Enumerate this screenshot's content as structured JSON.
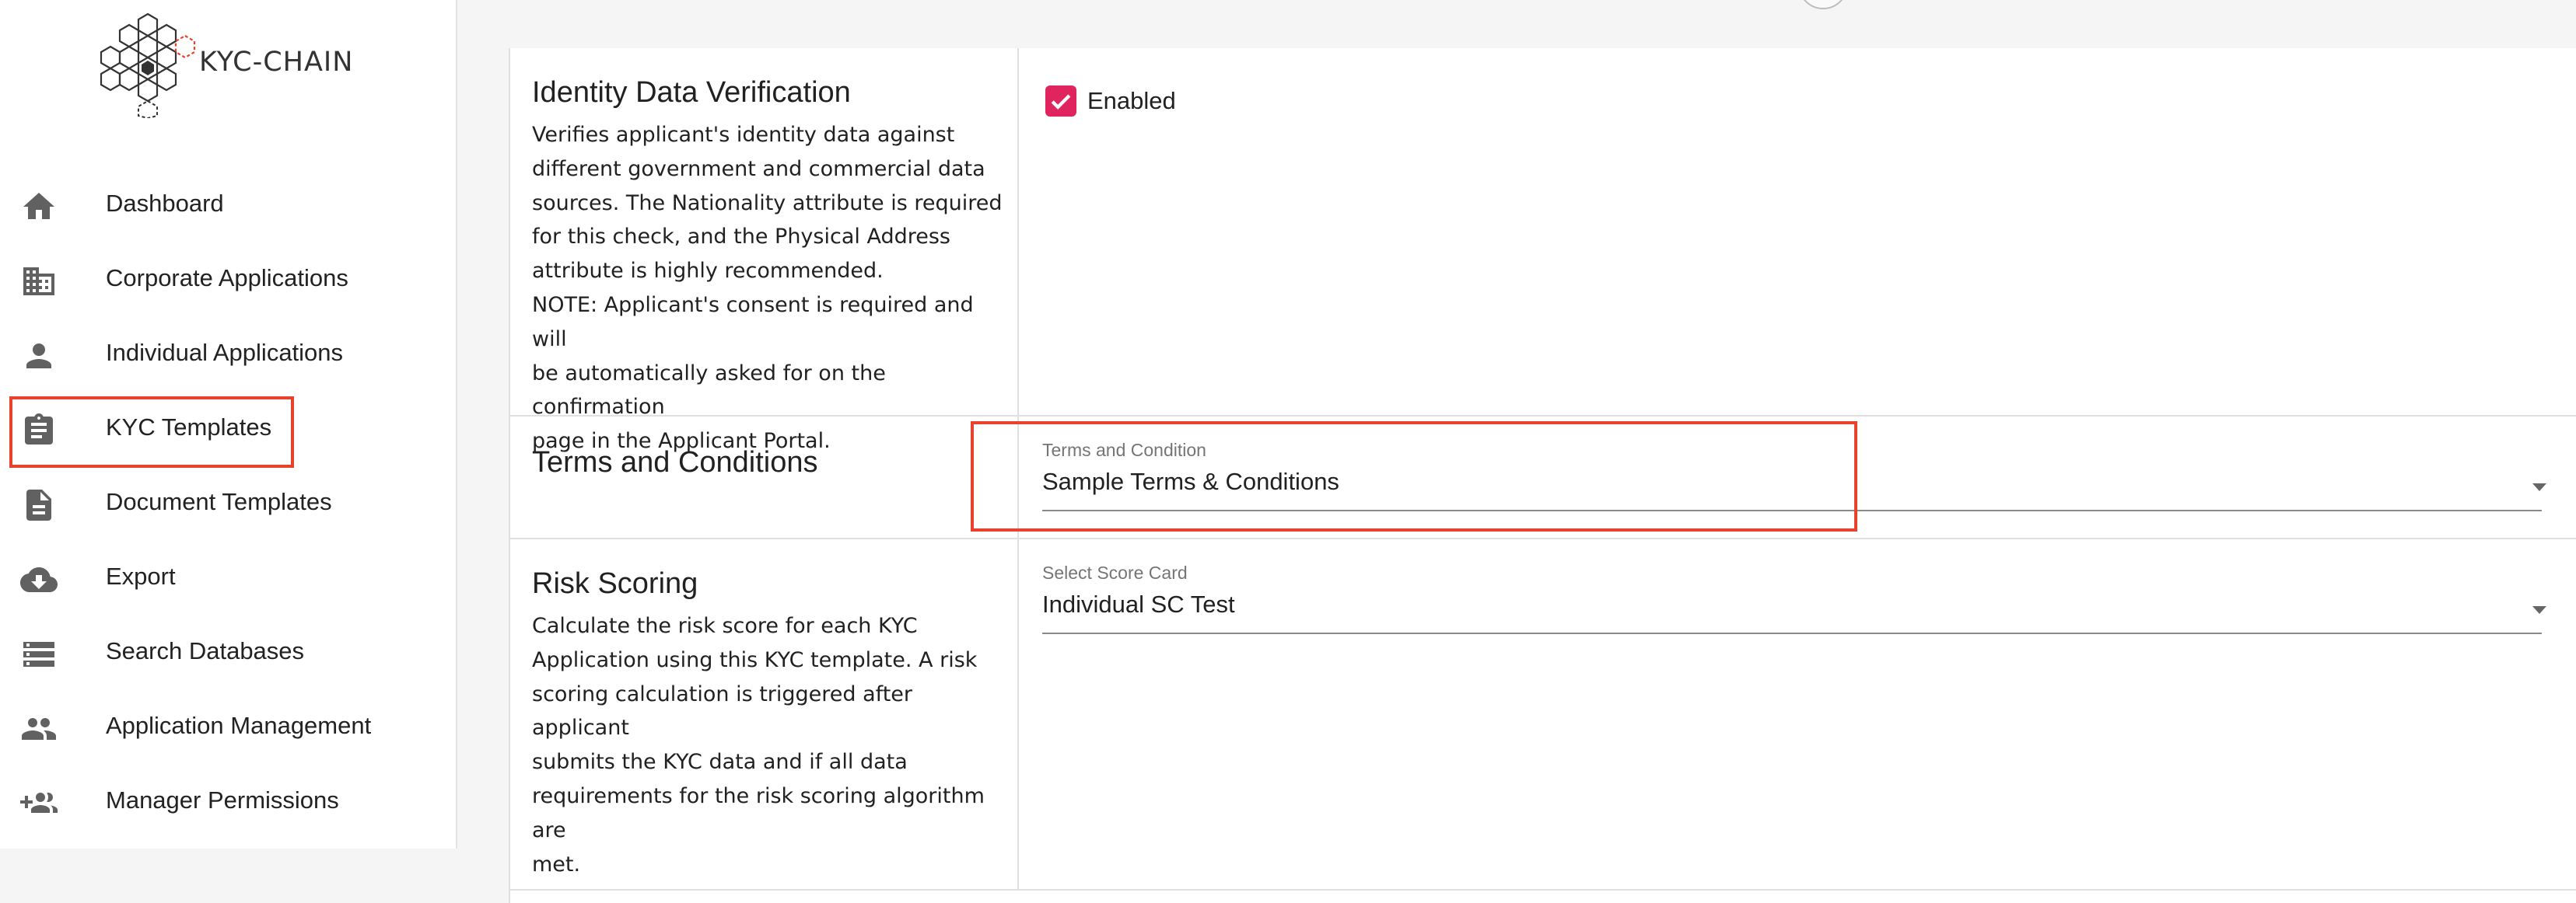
{
  "app": {
    "logo_text": "KYC-CHAIN"
  },
  "sidebar": {
    "items": [
      {
        "label": "Dashboard",
        "icon": "home-icon"
      },
      {
        "label": "Corporate Applications",
        "icon": "building-icon"
      },
      {
        "label": "Individual Applications",
        "icon": "person-icon"
      },
      {
        "label": "KYC Templates",
        "icon": "clipboard-icon"
      },
      {
        "label": "Document Templates",
        "icon": "document-icon"
      },
      {
        "label": "Export",
        "icon": "cloud-download-icon"
      },
      {
        "label": "Search Databases",
        "icon": "list-icon"
      },
      {
        "label": "Application Management",
        "icon": "group-icon"
      },
      {
        "label": "Manager Permissions",
        "icon": "add-group-icon"
      }
    ],
    "active": "KYC Templates"
  },
  "sections": {
    "identity": {
      "title": "Identity Data Verification",
      "description_lines": [
        "Verifies applicant's identity data against",
        "different government and commercial data",
        "sources. The Nationality attribute is required",
        "for this check, and the Physical Address",
        "attribute is highly recommended.",
        "NOTE: Applicant's consent is required and will",
        "be automatically asked for on the confirmation",
        "page in the Applicant Portal."
      ],
      "checkbox_label": "Enabled",
      "checked": true
    },
    "terms": {
      "title": "Terms and Conditions",
      "select_label": "Terms and Condition",
      "select_value": "Sample Terms & Conditions"
    },
    "risk": {
      "title": "Risk Scoring",
      "description_lines": [
        "Calculate the risk score for each KYC",
        "Application using this KYC template. A risk",
        "scoring calculation is triggered after applicant",
        "submits the KYC data and if all data",
        "requirements for the risk scoring algorithm are",
        "met."
      ],
      "select_label": "Select Score Card",
      "select_value": "Individual SC Test"
    }
  },
  "colors": {
    "accent": "#e0245e",
    "highlight": "#e8412c",
    "icon": "#616161"
  }
}
